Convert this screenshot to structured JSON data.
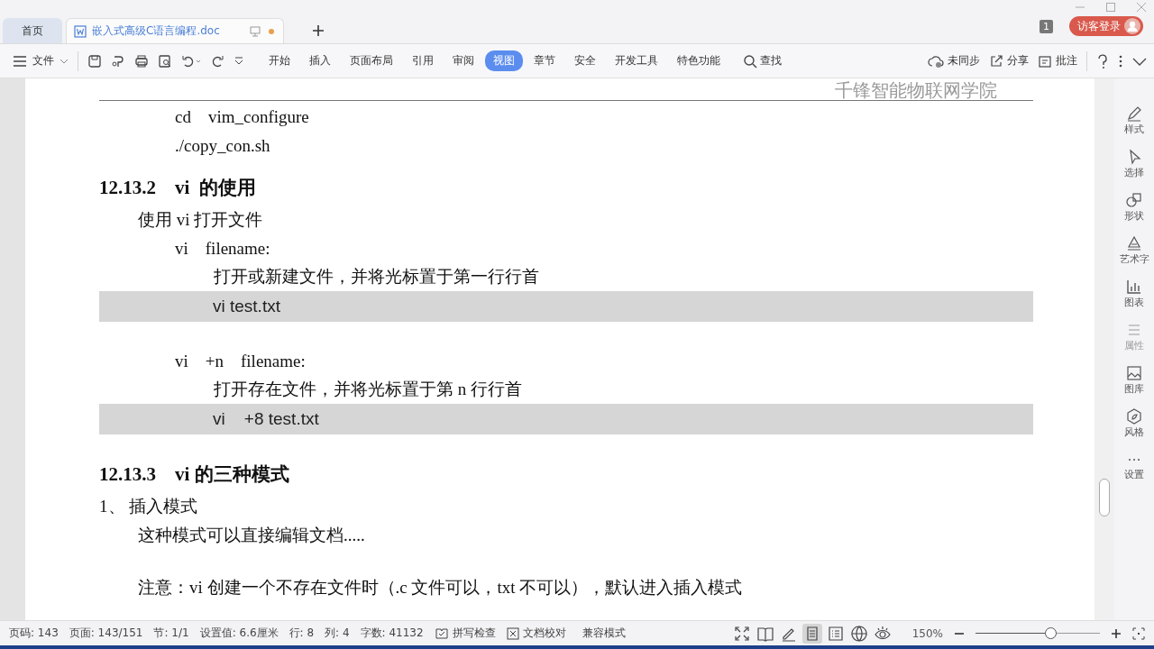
{
  "tabs": [
    {
      "label": "首页",
      "kind": "home",
      "selected": false
    },
    {
      "label": "嵌入式高级C语言编程.doc",
      "kind": "doc",
      "selected": true
    }
  ],
  "account": {
    "page_count": "1",
    "login": "访客登录"
  },
  "toolbar": {
    "file_menu": "文件",
    "ribbon_tabs": [
      {
        "label": "开始",
        "selected": false
      },
      {
        "label": "插入",
        "selected": false
      },
      {
        "label": "页面布局",
        "selected": false
      },
      {
        "label": "引用",
        "selected": false
      },
      {
        "label": "审阅",
        "selected": false
      },
      {
        "label": "视图",
        "selected": true
      },
      {
        "label": "章节",
        "selected": false
      },
      {
        "label": "安全",
        "selected": false
      },
      {
        "label": "开发工具",
        "selected": false
      },
      {
        "label": "特色功能",
        "selected": false
      }
    ],
    "search": "查找",
    "sync": "未同步",
    "share": "分享",
    "comment": "批注"
  },
  "document": {
    "header": "千锋智能物联网学院",
    "lines": [
      {
        "kind": "cmd",
        "text": "cd    vim_configure"
      },
      {
        "kind": "cmd",
        "text": "./copy_con.sh"
      },
      {
        "kind": "heading",
        "text": "12.13.2    vi  的使用"
      },
      {
        "kind": "para",
        "text": "使用 vi 打开文件"
      },
      {
        "kind": "cmd",
        "text": "vi    filename:"
      },
      {
        "kind": "sub",
        "text": "打开或新建文件，并将光标置于第一行行首"
      },
      {
        "kind": "shaded",
        "text": "vi test.txt"
      },
      {
        "kind": "cmd",
        "text": "vi    +n    filename:"
      },
      {
        "kind": "sub",
        "text": "打开存在文件，并将光标置于第 n 行行首"
      },
      {
        "kind": "shaded",
        "text": "vi    +8 test.txt"
      },
      {
        "kind": "heading",
        "text": "12.13.3    vi 的三种模式"
      },
      {
        "kind": "list",
        "text": "1、 插入模式"
      },
      {
        "kind": "para",
        "text": "这种模式可以直接编辑文档....."
      },
      {
        "kind": "note",
        "text": "注意：vi 创建一个不存在文件时（.c 文件可以，txt 不可以），默认进入插入模式"
      }
    ]
  },
  "sidebar": [
    {
      "label": "样式",
      "kind": "pen",
      "disabled": false
    },
    {
      "label": "选择",
      "kind": "cursor",
      "disabled": false
    },
    {
      "label": "形状",
      "kind": "shape",
      "disabled": false
    },
    {
      "label": "艺术字",
      "kind": "art",
      "disabled": false
    },
    {
      "label": "图表",
      "kind": "chart",
      "disabled": false
    },
    {
      "label": "属性",
      "kind": "props",
      "disabled": true
    },
    {
      "label": "图库",
      "kind": "image",
      "disabled": false
    },
    {
      "label": "风格",
      "kind": "style",
      "disabled": false
    },
    {
      "label": "设置",
      "kind": "dots",
      "disabled": false
    }
  ],
  "status_bar": {
    "items": [
      "页码: 143",
      "页面: 143/151",
      "节: 1/1",
      "设置值: 6.6厘米",
      "行: 8",
      "列: 4",
      "字数: 41132"
    ],
    "spell_check": "拼写检查",
    "doc_proof": "文档校对",
    "compat": "兼容模式",
    "views": [
      {
        "kind": "fullscreen",
        "selected": false
      },
      {
        "kind": "read",
        "selected": false
      },
      {
        "kind": "write",
        "selected": false
      },
      {
        "kind": "page",
        "selected": true
      },
      {
        "kind": "outline",
        "selected": false
      },
      {
        "kind": "web",
        "selected": false
      },
      {
        "kind": "eye",
        "selected": false
      }
    ],
    "zoom": "150%",
    "zoom_slider": {
      "level": 0.6
    }
  }
}
